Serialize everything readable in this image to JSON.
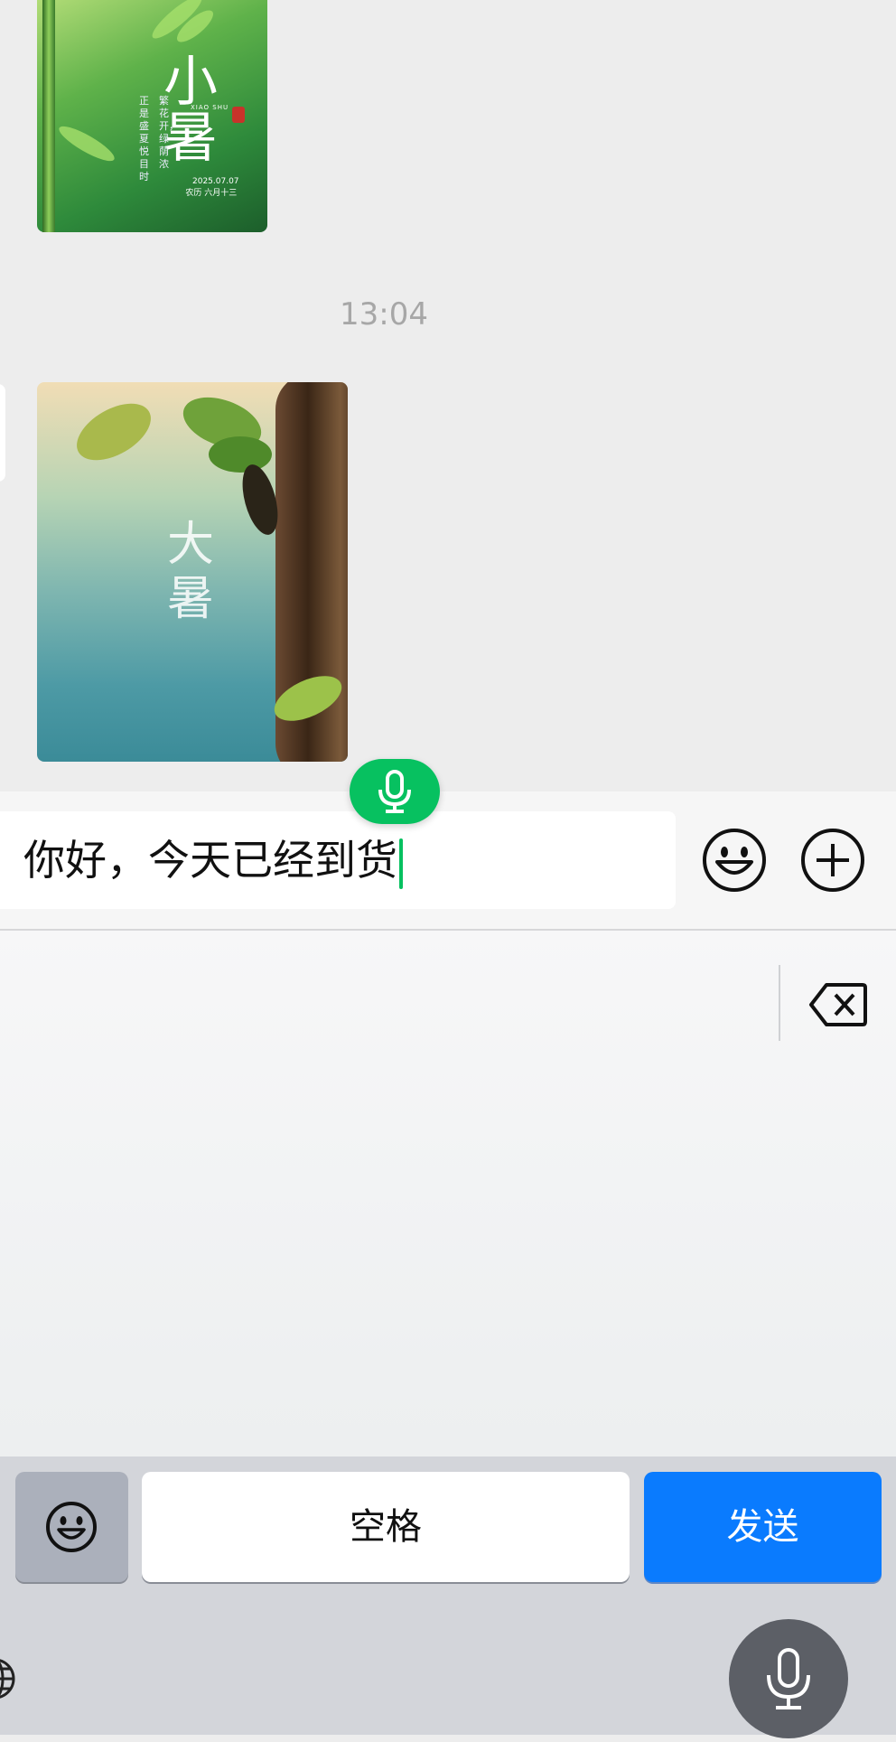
{
  "chat": {
    "image1": {
      "title_glyph": "小暑",
      "pinyin": "XIAO SHU",
      "poem_line1": "繁花开，绿荫浓",
      "poem_line2": "正是盛夏悦目时",
      "date": "2025.07.07",
      "lunar": "农历 六月十三"
    },
    "timestamp": "13:04",
    "image2": {
      "title_glyph": "大暑"
    }
  },
  "input": {
    "text": "你好，今天已经到货"
  },
  "keyboard": {
    "space_label": "空格",
    "send_label": "发送"
  },
  "colors": {
    "wechat_green": "#07c160",
    "send_blue": "#0a7bfe"
  },
  "icons": [
    "mic-icon",
    "emoji-icon",
    "plus-icon",
    "backspace-icon",
    "globe-icon",
    "dictation-mic-icon"
  ]
}
